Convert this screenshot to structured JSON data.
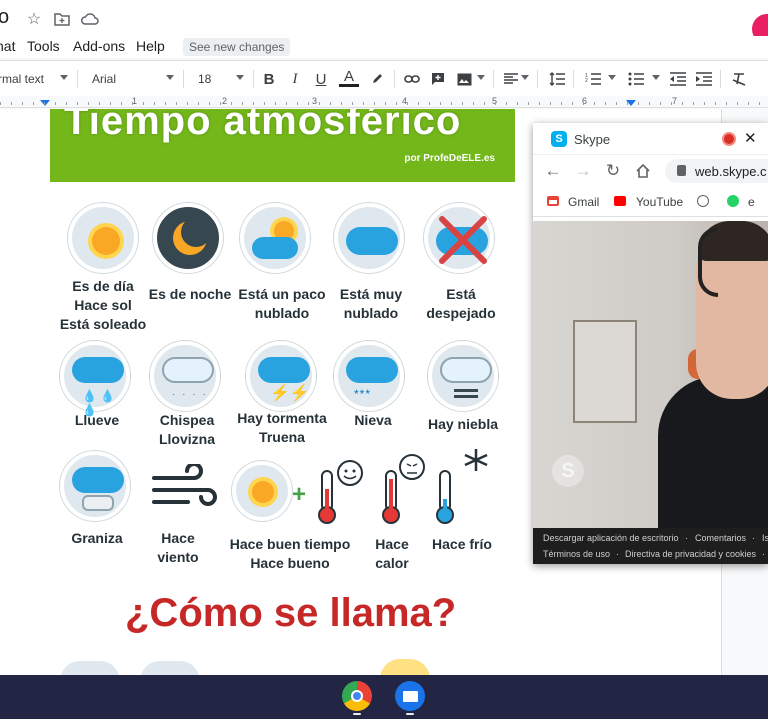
{
  "docs": {
    "title_fragment": "o",
    "menu": [
      "nat",
      "Tools",
      "Add-ons",
      "Help"
    ],
    "see_changes": "See new changes",
    "toolbar": {
      "style": "rmal text",
      "font": "Arial",
      "size": "18"
    },
    "ruler_numbers": [
      "1",
      "2",
      "3",
      "4",
      "5",
      "6",
      "7"
    ]
  },
  "worksheet": {
    "title": "Tiempo atmosférico",
    "credit": "por ProfeDeELE.es",
    "items": [
      {
        "label": "Es de día\nHace sol\nEstá soleado"
      },
      {
        "label": "Es de noche"
      },
      {
        "label": "Está un paco\nnublado"
      },
      {
        "label": "Está muy\nnublado"
      },
      {
        "label": "Está\ndespejado"
      },
      {
        "label": "Llueve"
      },
      {
        "label": "Chispea\nLlovizna"
      },
      {
        "label": "Hay tormenta\nTruena"
      },
      {
        "label": "Nieva"
      },
      {
        "label": "Hay niebla"
      },
      {
        "label": "Graniza"
      },
      {
        "label": "Hace\nviento"
      },
      {
        "label": "Hace buen tiempo\nHace bueno"
      },
      {
        "label": "Hace\ncalor"
      },
      {
        "label": "Hace frío"
      }
    ],
    "question": "¿Cómo se llama?"
  },
  "skype": {
    "tab_title": "Skype",
    "url": "web.skype.c",
    "bookmarks": [
      "Gmail",
      "YouTube",
      "e"
    ],
    "footer": {
      "row1": [
        "Descargar aplicación de escritorio",
        "·",
        "Comentarios",
        "·",
        "Is"
      ],
      "row2": [
        "Términos de uso",
        "·",
        "Directiva de privacidad y cookies",
        "·"
      ]
    },
    "watermark": "S"
  },
  "shelf": {
    "apps": [
      "Chrome",
      "Files"
    ]
  }
}
